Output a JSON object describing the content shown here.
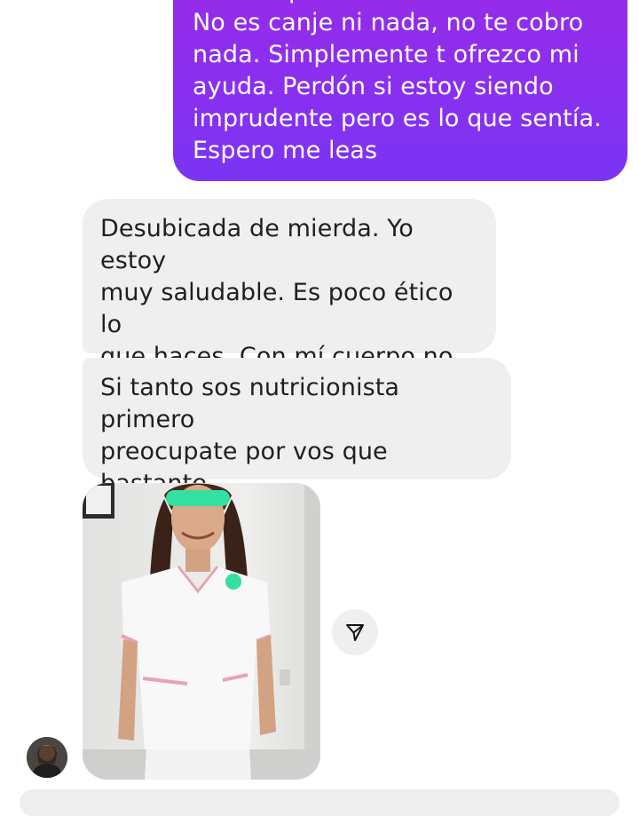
{
  "messages": {
    "outgoing": "ofrezco para darme una mano.\nNo es canje ni nada, no te cobro\nnada. Simplemente t ofrezco mi\nayuda. Perdón si estoy siendo\nimprudente pero es lo que sentía.\nEspero me leas",
    "incoming_1": "Desubicada de mierda. Yo estoy\nmuy saludable. Es poco ético lo\nque haces. Con mí cuerpo no te\nmetas.",
    "incoming_2": "Si tanto sos nutricionista primero\npreocupate por vos que bastante\nexcedida estas"
  },
  "icons": {
    "share": "paper-plane-icon",
    "avatar": "contact-avatar"
  },
  "colors": {
    "outgoing_gradient_start": "#9a2ae6",
    "outgoing_gradient_end": "#7b34f3",
    "incoming_bubble": "#efefef",
    "censor_bar": "#33e0a0"
  }
}
